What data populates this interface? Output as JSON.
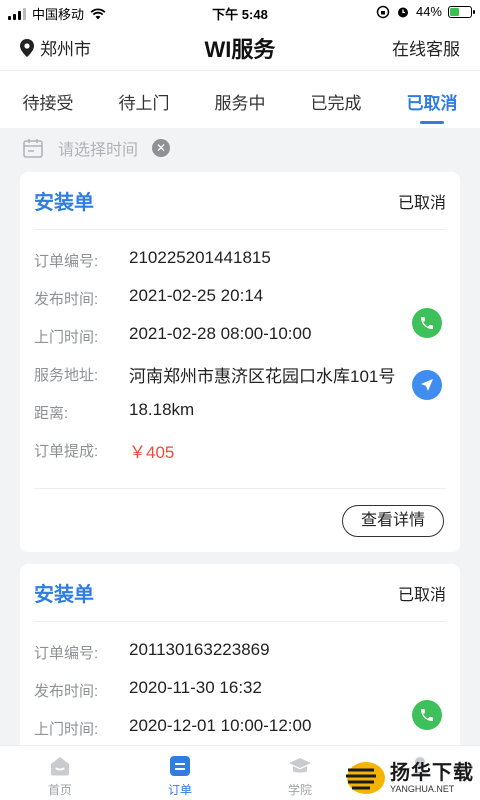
{
  "status_bar": {
    "carrier": "中国移动",
    "time": "下午 5:48",
    "battery": "44%",
    "battery_level": 0.44
  },
  "header": {
    "location": "郑州市",
    "title": "WI服务",
    "service_link": "在线客服"
  },
  "tabs": [
    {
      "label": "待接受",
      "active": false
    },
    {
      "label": "待上门",
      "active": false
    },
    {
      "label": "服务中",
      "active": false
    },
    {
      "label": "已完成",
      "active": false
    },
    {
      "label": "已取消",
      "active": true
    }
  ],
  "filter": {
    "placeholder": "请选择时间"
  },
  "orders": [
    {
      "type": "安装单",
      "status": "已取消",
      "fields": [
        {
          "label": "订单编号:",
          "value": "210225201441815"
        },
        {
          "label": "发布时间:",
          "value": "2021-02-25 20:14"
        },
        {
          "label": "上门时间:",
          "value": "2021-02-28 08:00-10:00"
        },
        {
          "label": "服务地址:",
          "value": "河南郑州市惠济区花园口水库101号"
        },
        {
          "label": "距离:",
          "value": "18.18km"
        },
        {
          "label": "订单提成:",
          "value": "￥405"
        }
      ],
      "detail_button": "查看详情"
    },
    {
      "type": "安装单",
      "status": "已取消",
      "fields": [
        {
          "label": "订单编号:",
          "value": "201130163223869"
        },
        {
          "label": "发布时间:",
          "value": "2020-11-30 16:32"
        },
        {
          "label": "上门时间:",
          "value": "2020-12-01 10:00-12:00"
        }
      ]
    }
  ],
  "tabbar": [
    {
      "label": "首页",
      "icon": "home-icon",
      "active": false
    },
    {
      "label": "订单",
      "icon": "order-icon",
      "active": true
    },
    {
      "label": "学院",
      "icon": "academy-icon",
      "active": false
    },
    {
      "label": "",
      "icon": "profile-icon",
      "active": false
    }
  ],
  "watermark": {
    "main": "扬华下载",
    "sub": "YANGHUA.NET"
  },
  "colors": {
    "accent": "#2f7de1",
    "price": "#f24a3d",
    "phone": "#3ec15b",
    "navigate": "#3f8df0"
  }
}
